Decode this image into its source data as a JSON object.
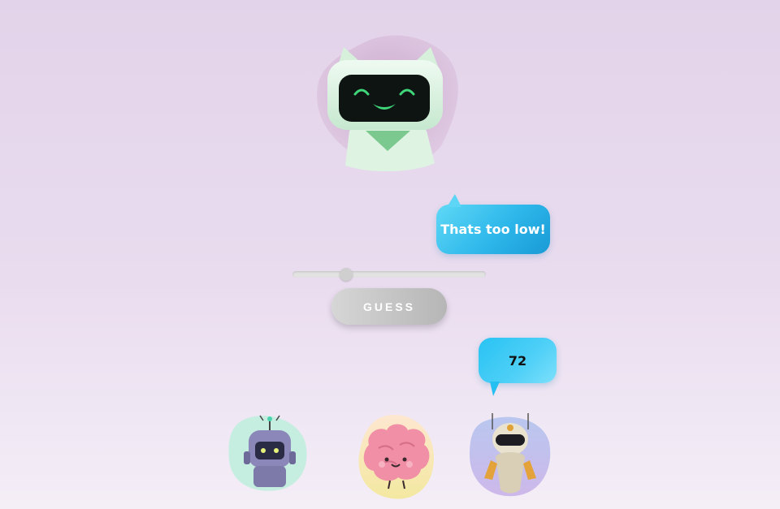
{
  "feedback": {
    "message": "Thats too low!"
  },
  "controls": {
    "slider_value_fraction": 0.26,
    "guess_button_label": "GUESS"
  },
  "guess_display": {
    "value": "72"
  },
  "avatars": {
    "host": "cat-robot-icon",
    "players": [
      "robot-icon",
      "brain-icon",
      "android-icon"
    ]
  },
  "colors": {
    "bubble_blue": "#2db7ea",
    "background_lavender": "#e3d3ea",
    "button_gray": "#c4c4c4"
  }
}
